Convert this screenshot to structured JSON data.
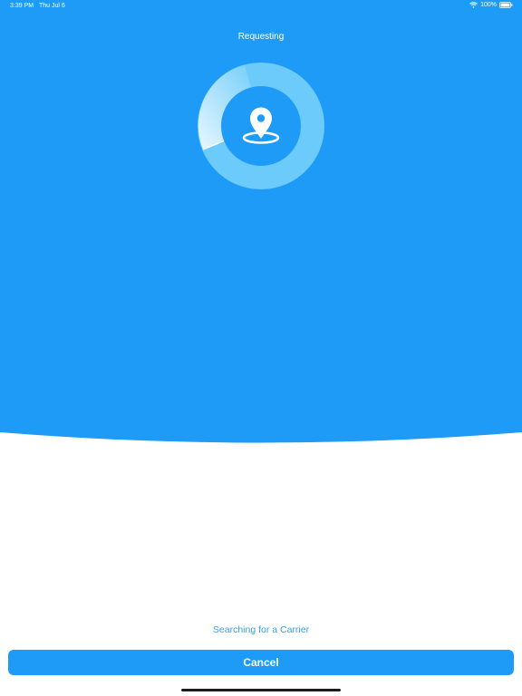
{
  "status_bar": {
    "time": "3:39 PM",
    "date": "Thu Jul 6",
    "battery": "100%",
    "wifi_icon": "wifi-icon",
    "battery_icon": "battery-full-icon"
  },
  "header": {
    "title": "Requesting"
  },
  "radar": {
    "icon": "location-pin-icon"
  },
  "footer": {
    "status_text": "Searching for a Carrier",
    "cancel_label": "Cancel"
  },
  "colors": {
    "brand_blue": "#1e9bf7",
    "radar_ring": "#6ccbfa",
    "radar_core": "#1e9bf7",
    "text_blue": "#3a9de6",
    "button_text": "#ffffff"
  }
}
